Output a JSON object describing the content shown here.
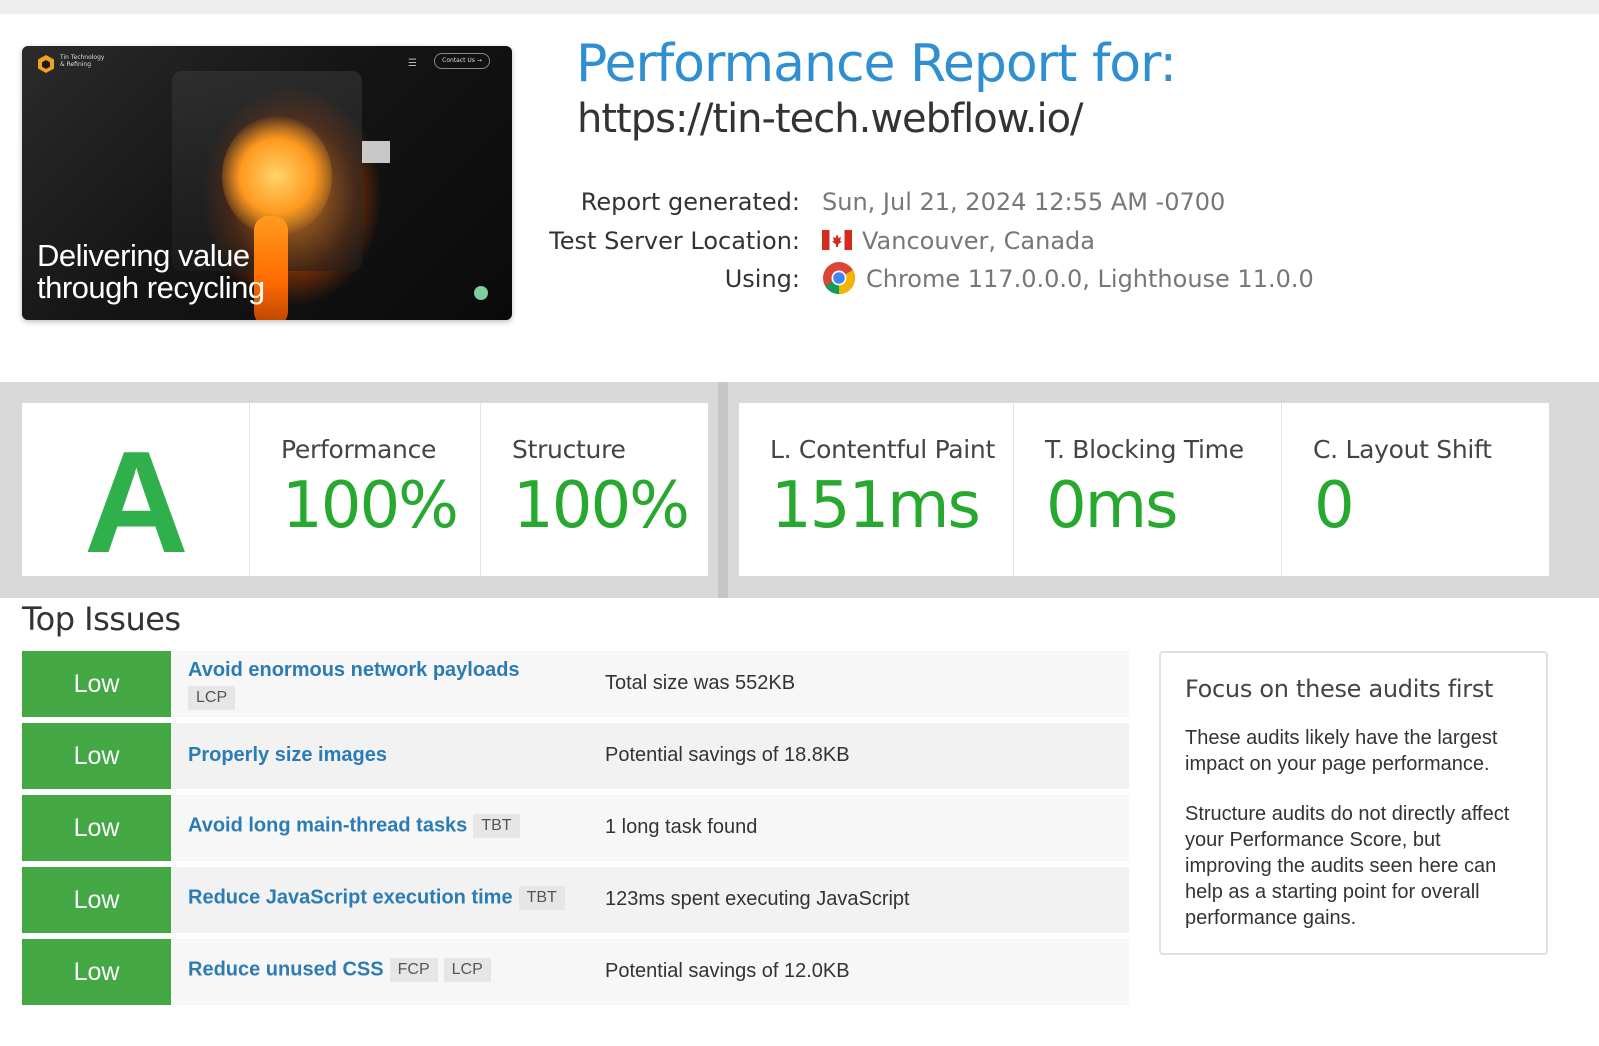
{
  "thumbnail": {
    "brand_text": "Tin Technology & Refining",
    "contact_label": "Contact Us →",
    "headline_line1": "Delivering value",
    "headline_line2": "through recycling"
  },
  "header": {
    "title": "Performance Report for:",
    "url": "https://tin-tech.webflow.io/"
  },
  "meta": {
    "generated_label": "Report generated:",
    "generated_value": "Sun, Jul 21, 2024 12:55 AM -0700",
    "location_label": "Test Server Location:",
    "location_value": "Vancouver, Canada",
    "using_label": "Using:",
    "using_value": "Chrome 117.0.0.0, Lighthouse 11.0.0"
  },
  "scores": {
    "grade": "A",
    "performance_label": "Performance",
    "performance_value": "100%",
    "structure_label": "Structure",
    "structure_value": "100%",
    "lcp_label": "L. Contentful Paint",
    "lcp_value": "151ms",
    "tbt_label": "T. Blocking Time",
    "tbt_value": "0ms",
    "cls_label": "C. Layout Shift",
    "cls_value": "0"
  },
  "issues": {
    "title": "Top Issues",
    "rows": [
      {
        "severity": "Low",
        "name": "Avoid enormous network payloads",
        "tags": [
          "LCP"
        ],
        "desc": "Total size was 552KB"
      },
      {
        "severity": "Low",
        "name": "Properly size images",
        "tags": [],
        "desc": "Potential savings of 18.8KB"
      },
      {
        "severity": "Low",
        "name": "Avoid long main-thread tasks",
        "tags": [
          "TBT"
        ],
        "desc": "1 long task found"
      },
      {
        "severity": "Low",
        "name": "Reduce JavaScript execution time",
        "tags": [
          "TBT"
        ],
        "desc": "123ms spent executing JavaScript"
      },
      {
        "severity": "Low",
        "name": "Reduce unused CSS",
        "tags": [
          "FCP",
          "LCP"
        ],
        "desc": "Potential savings of 12.0KB"
      }
    ]
  },
  "focus": {
    "title": "Focus on these audits first",
    "para1": "These audits likely have the largest impact on your page performance.",
    "para2": "Structure audits do not directly affect your Performance Score, but improving the audits seen here can help as a starting point for overall performance gains."
  },
  "colors": {
    "title_blue": "#2f8fd0",
    "grade_green": "#2fb04a",
    "score_green": "#27a82f",
    "severity_low": "#43a843",
    "link_blue": "#2b7bb5"
  }
}
